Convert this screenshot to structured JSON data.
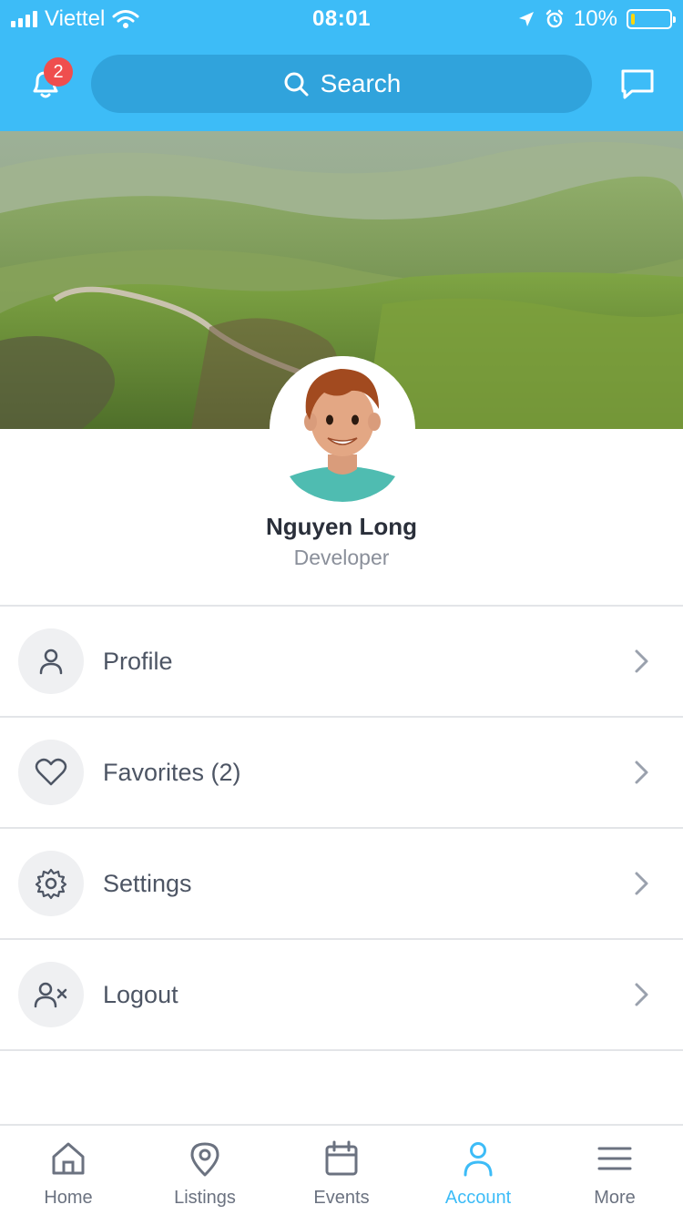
{
  "status_bar": {
    "carrier": "Viettel",
    "time": "08:01",
    "battery_text": "10%",
    "battery_level": 0.1,
    "icons": [
      "signal-icon",
      "wifi-icon",
      "location-arrow-icon",
      "alarm-icon",
      "battery-icon"
    ]
  },
  "header": {
    "notifications": {
      "icon": "bell-icon",
      "badge": "2"
    },
    "search": {
      "icon": "search-icon",
      "placeholder": "Search"
    },
    "chat": {
      "icon": "chat-icon"
    },
    "accent_color": "#3dbcf7"
  },
  "profile": {
    "name": "Nguyen Long",
    "role": "Developer"
  },
  "menu": [
    {
      "label": "Profile",
      "icon": "user-icon"
    },
    {
      "label": "Favorites (2)",
      "icon": "heart-icon"
    },
    {
      "label": "Settings",
      "icon": "gear-icon"
    },
    {
      "label": "Logout",
      "icon": "user-remove-icon"
    }
  ],
  "tabs": [
    {
      "label": "Home",
      "icon": "home-icon"
    },
    {
      "label": "Listings",
      "icon": "map-pin-icon"
    },
    {
      "label": "Events",
      "icon": "calendar-icon"
    },
    {
      "label": "Account",
      "icon": "user-icon",
      "active": true
    },
    {
      "label": "More",
      "icon": "menu-icon"
    }
  ]
}
